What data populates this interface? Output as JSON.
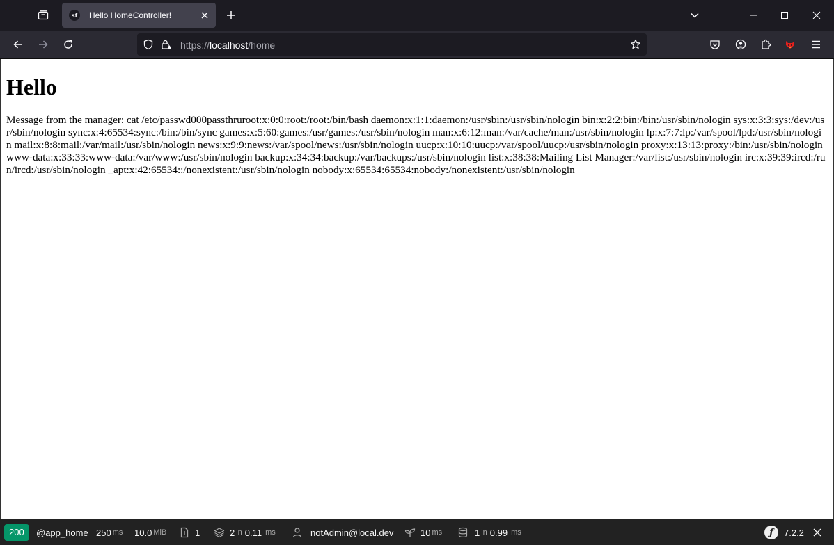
{
  "browser": {
    "tab_title": "Hello HomeController!",
    "favicon_text": "sf",
    "url_scheme": "https://",
    "url_host": "localhost",
    "url_path": "/home"
  },
  "page": {
    "heading": "Hello",
    "message": "Message from the manager: cat /etc/passwd000passthruroot:x:0:0:root:/root:/bin/bash daemon:x:1:1:daemon:/usr/sbin:/usr/sbin/nologin bin:x:2:2:bin:/bin:/usr/sbin/nologin sys:x:3:3:sys:/dev:/usr/sbin/nologin sync:x:4:65534:sync:/bin:/bin/sync games:x:5:60:games:/usr/games:/usr/sbin/nologin man:x:6:12:man:/var/cache/man:/usr/sbin/nologin lp:x:7:7:lp:/var/spool/lpd:/usr/sbin/nologin mail:x:8:8:mail:/var/mail:/usr/sbin/nologin news:x:9:9:news:/var/spool/news:/usr/sbin/nologin uucp:x:10:10:uucp:/var/spool/uucp:/usr/sbin/nologin proxy:x:13:13:proxy:/bin:/usr/sbin/nologin www-data:x:33:33:www-data:/var/www:/usr/sbin/nologin backup:x:34:34:backup:/var/backups:/usr/sbin/nologin list:x:38:38:Mailing List Manager:/var/list:/usr/sbin/nologin irc:x:39:39:ircd:/run/ircd:/usr/sbin/nologin _apt:x:42:65534::/nonexistent:/usr/sbin/nologin nobody:x:65534:65534:nobody:/nonexistent:/usr/sbin/nologin"
  },
  "toolbar": {
    "status_code": "200",
    "route": "@app_home",
    "time_value": "250",
    "time_unit": "ms",
    "memory_value": "10.0",
    "memory_unit": "MiB",
    "forms_count": "1",
    "cache_value": "2",
    "cache_in": "in",
    "cache_time": "0.11",
    "cache_unit": "ms",
    "user": "notAdmin@local.dev",
    "twig_value": "10",
    "twig_unit": "ms",
    "db_value": "1",
    "db_in": "in",
    "db_time": "0.99",
    "db_unit": "ms",
    "symfony_version": "7.2.2"
  },
  "colors": {
    "status_ok": "#059669",
    "tab_bg": "#42414d",
    "navbar_bg": "#2b2a33",
    "toolbar_bg": "#222222"
  }
}
